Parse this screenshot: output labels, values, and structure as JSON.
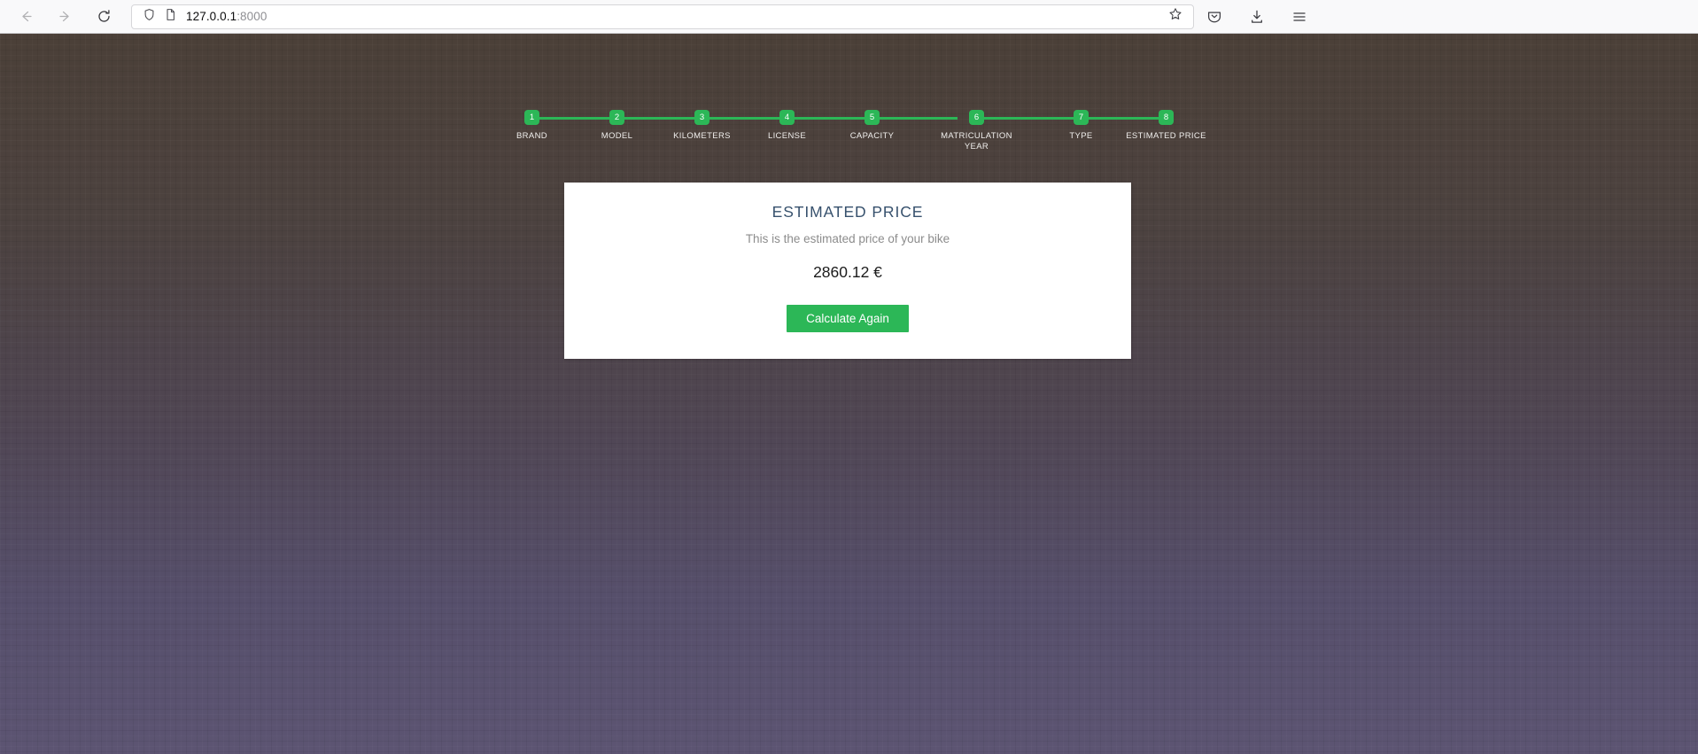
{
  "browser": {
    "nav": {
      "back_label": "Back",
      "forward_label": "Forward",
      "reload_label": "Reload"
    },
    "url": {
      "host": "127.0.0.1",
      "port": ":8000",
      "shield_icon": "shield-icon",
      "page_icon": "page-icon",
      "bookmark_icon": "star-icon"
    },
    "right_actions": [
      {
        "name": "pocket-icon",
        "label": "Save to Pocket"
      },
      {
        "name": "downloads-icon",
        "label": "Downloads"
      },
      {
        "name": "menu-icon",
        "label": "Open application menu"
      }
    ]
  },
  "stepper": {
    "steps": [
      {
        "number": "1",
        "label": "BRAND"
      },
      {
        "number": "2",
        "label": "MODEL"
      },
      {
        "number": "3",
        "label": "KILOMETERS"
      },
      {
        "number": "4",
        "label": "LICENSE"
      },
      {
        "number": "5",
        "label": "CAPACITY"
      },
      {
        "number": "6",
        "label": "MATRICULATION\nYEAR"
      },
      {
        "number": "7",
        "label": "TYPE"
      },
      {
        "number": "8",
        "label": "ESTIMATED PRICE"
      }
    ],
    "active_color": "#2cb757"
  },
  "card": {
    "title": "ESTIMATED PRICE",
    "subtitle": "This is the estimated price of your bike",
    "price": "2860.12 €",
    "button_label": "Calculate Again",
    "accent_color": "#2cb757",
    "title_color": "#37516d"
  }
}
